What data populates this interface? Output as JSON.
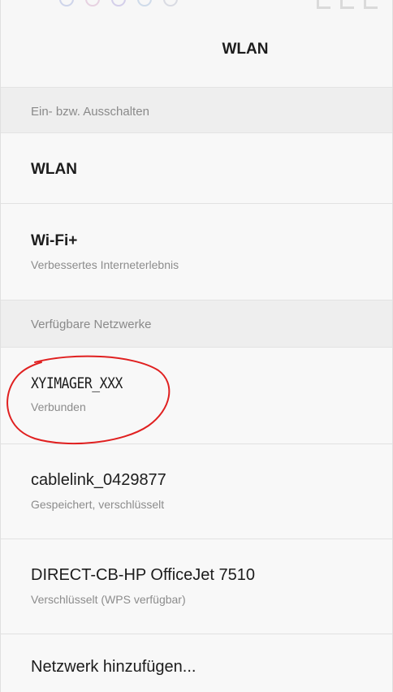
{
  "header": {
    "title": "WLAN"
  },
  "sections": {
    "toggle": "Ein- bzw. Ausschalten",
    "available": "Verfügbare Netzwerke"
  },
  "settings": {
    "wlan": {
      "title": "WLAN"
    },
    "wifi_plus": {
      "title": "Wi-Fi+",
      "subtitle": "Verbessertes Interneterlebnis"
    }
  },
  "networks": [
    {
      "name": "XYIMAGER_XXX",
      "status": "Verbunden"
    },
    {
      "name": "cablelink_0429877",
      "status": "Gespeichert, verschlüsselt"
    },
    {
      "name": "DIRECT-CB-HP OfficeJet 7510",
      "status": "Verschlüsselt (WPS verfügbar)"
    }
  ],
  "add_network": {
    "label": "Netzwerk hinzufügen..."
  },
  "colors": {
    "annotation": "#e02020",
    "section_background": "#eeeeee",
    "row_background": "#f8f8f8"
  }
}
